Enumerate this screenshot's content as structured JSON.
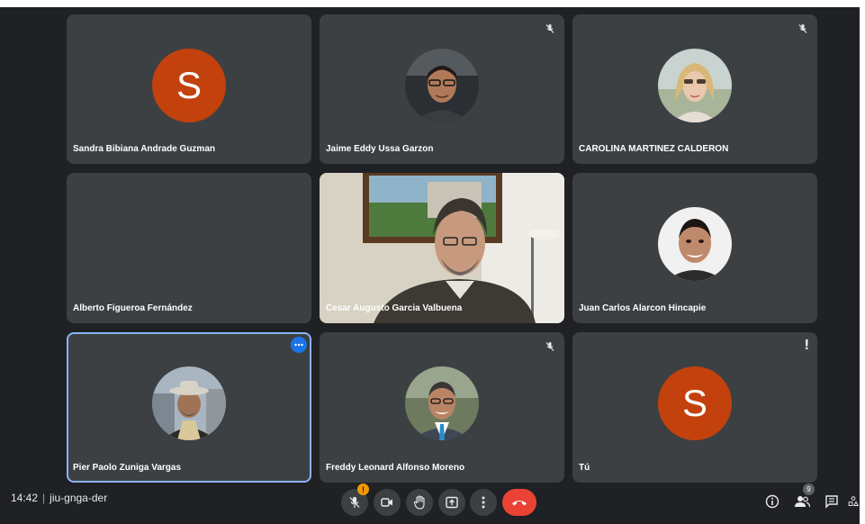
{
  "participants": [
    {
      "name": "Sandra Bibiana Andrade Guzman",
      "avatar_letter": "S"
    },
    {
      "name": "Jaime Eddy Ussa Garzon"
    },
    {
      "name": "CAROLINA MARTINEZ CALDERON"
    },
    {
      "name": "Alberto Figueroa Fernández"
    },
    {
      "name": "Cesar Augusto Garcia Valbuena"
    },
    {
      "name": "Juan Carlos Alarcon Hincapie"
    },
    {
      "name": "Pier Paolo Zuniga Vargas"
    },
    {
      "name": "Freddy Leonard Alfonso Moreno"
    },
    {
      "name": "Tú",
      "avatar_letter": "S",
      "alert": "!"
    }
  ],
  "bottom_bar": {
    "time": "14:42",
    "separator": "|",
    "meeting_code": "jiu-gnga-der",
    "mic_alert": "!",
    "participant_count": "9"
  },
  "colors": {
    "background": "#202124",
    "tile": "#3c4043",
    "avatar_orange": "#c2410c",
    "end_call": "#ea4335",
    "active_border": "#8ab4f8"
  },
  "icons": [
    "mic-off-icon",
    "camera-icon",
    "raise-hand-icon",
    "present-icon",
    "more-options-icon",
    "end-call-icon",
    "info-icon",
    "people-icon",
    "chat-icon",
    "activities-icon"
  ]
}
